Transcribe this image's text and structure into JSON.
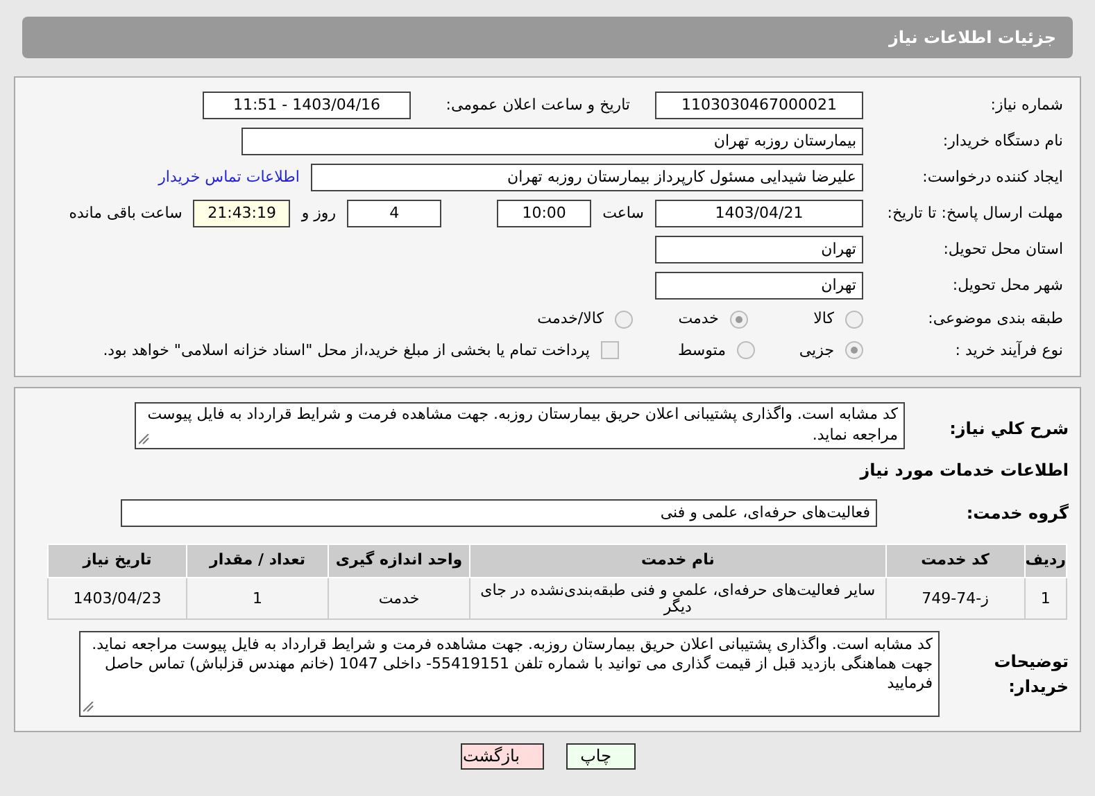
{
  "header": {
    "title": "جزئیات اطلاعات نیاز"
  },
  "need_number": {
    "label": "شماره نیاز:",
    "value": "1103030467000021"
  },
  "announce": {
    "label": "تاریخ و ساعت اعلان عمومی:",
    "value": "1403/04/16 - 11:51"
  },
  "buyer": {
    "label": "نام دستگاه خریدار:",
    "value": "بیمارستان روزبه تهران"
  },
  "creator": {
    "label": "ایجاد کننده درخواست:",
    "value": "علیرضا شیدایی مسئول کارپرداز بیمارستان روزبه تهران",
    "link": "اطلاعات تماس خریدار"
  },
  "deadline": {
    "label": "مهلت ارسال پاسخ: تا تاریخ:",
    "date": "1403/04/21",
    "time_label": "ساعت",
    "time": "10:00",
    "days": "4",
    "days_label": "روز و",
    "remaining": "21:43:19",
    "remaining_label": "ساعت باقی مانده"
  },
  "province": {
    "label": "استان محل تحویل:",
    "value": "تهران"
  },
  "city": {
    "label": "شهر محل تحویل:",
    "value": "تهران"
  },
  "category": {
    "label": "طبقه بندی موضوعی:",
    "options": [
      {
        "label": "کالا",
        "selected": false
      },
      {
        "label": "خدمت",
        "selected": true
      },
      {
        "label": "کالا/خدمت",
        "selected": false
      }
    ]
  },
  "process": {
    "label": "نوع فرآیند خرید :",
    "options": [
      {
        "label": "جزیی",
        "selected": true
      },
      {
        "label": "متوسط",
        "selected": false
      }
    ],
    "payment": {
      "label": "پرداخت تمام یا بخشی از مبلغ خرید،از محل \"اسناد خزانه اسلامی\" خواهد بود.",
      "checked": false
    }
  },
  "description": {
    "label": "شرح کلي نياز:",
    "value": "کد مشابه است. واگذاری پشتیبانی اعلان حریق بیمارستان روزبه. جهت مشاهده فرمت و شرایط قرارداد به فایل پیوست مراجعه نماید."
  },
  "services_heading": "اطلاعات خدمات مورد نیاز",
  "service_group": {
    "label": "گروه خدمت:",
    "value": "فعالیت‌های حرفه‌ای، علمی و فنی"
  },
  "table": {
    "columns": [
      "ردیف",
      "کد خدمت",
      "نام خدمت",
      "واحد اندازه گیری",
      "تعداد / مقدار",
      "تاریخ نیاز"
    ],
    "rows": [
      [
        "1",
        "ز-74-749",
        "سایر فعالیت‌های حرفه‌ای، علمی و فنی طبقه‌بندی‌نشده در جای دیگر",
        "خدمت",
        "1",
        "1403/04/23"
      ]
    ]
  },
  "buyer_notes": {
    "label": "توضیحات خریدار:",
    "value": "کد مشابه است. واگذاری پشتیبانی اعلان حریق بیمارستان روزبه. جهت مشاهده فرمت و شرایط قرارداد به فایل پیوست مراجعه نماید. جهت هماهنگی بازدید قبل از قیمت گذاری می توانید با شماره تلفن 55419151- داخلی 1047 (خانم مهندس قزلباش) تماس حاصل فرمایید"
  },
  "buttons": [
    {
      "label": "چاپ",
      "kind": "print"
    },
    {
      "label": "بازگشت",
      "kind": "back"
    }
  ]
}
